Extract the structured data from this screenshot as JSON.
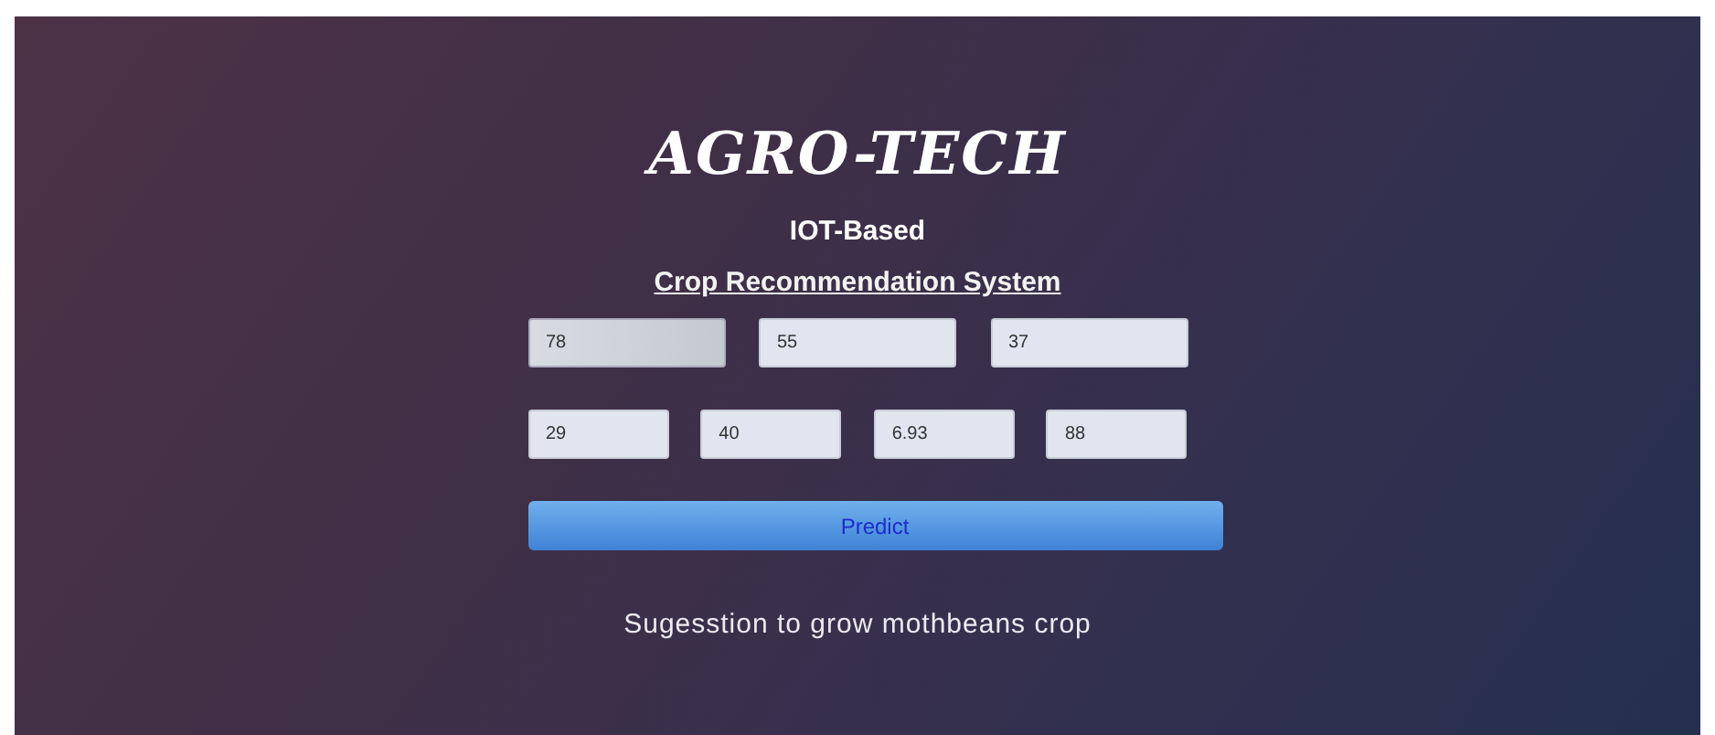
{
  "title": "AGRO-TECH",
  "subtitle": "IOT-Based",
  "heading": "Crop Recommendation System",
  "field_rows": [
    [
      {
        "value": "78",
        "focused": true
      },
      {
        "value": "55",
        "focused": false
      },
      {
        "value": "37",
        "focused": false
      }
    ],
    [
      {
        "value": "29",
        "focused": false
      },
      {
        "value": "40",
        "focused": false
      },
      {
        "value": "6.93",
        "focused": false
      },
      {
        "value": "88",
        "focused": false
      }
    ]
  ],
  "button": "Predict",
  "result": "Sugesstion to grow mothbeans crop"
}
